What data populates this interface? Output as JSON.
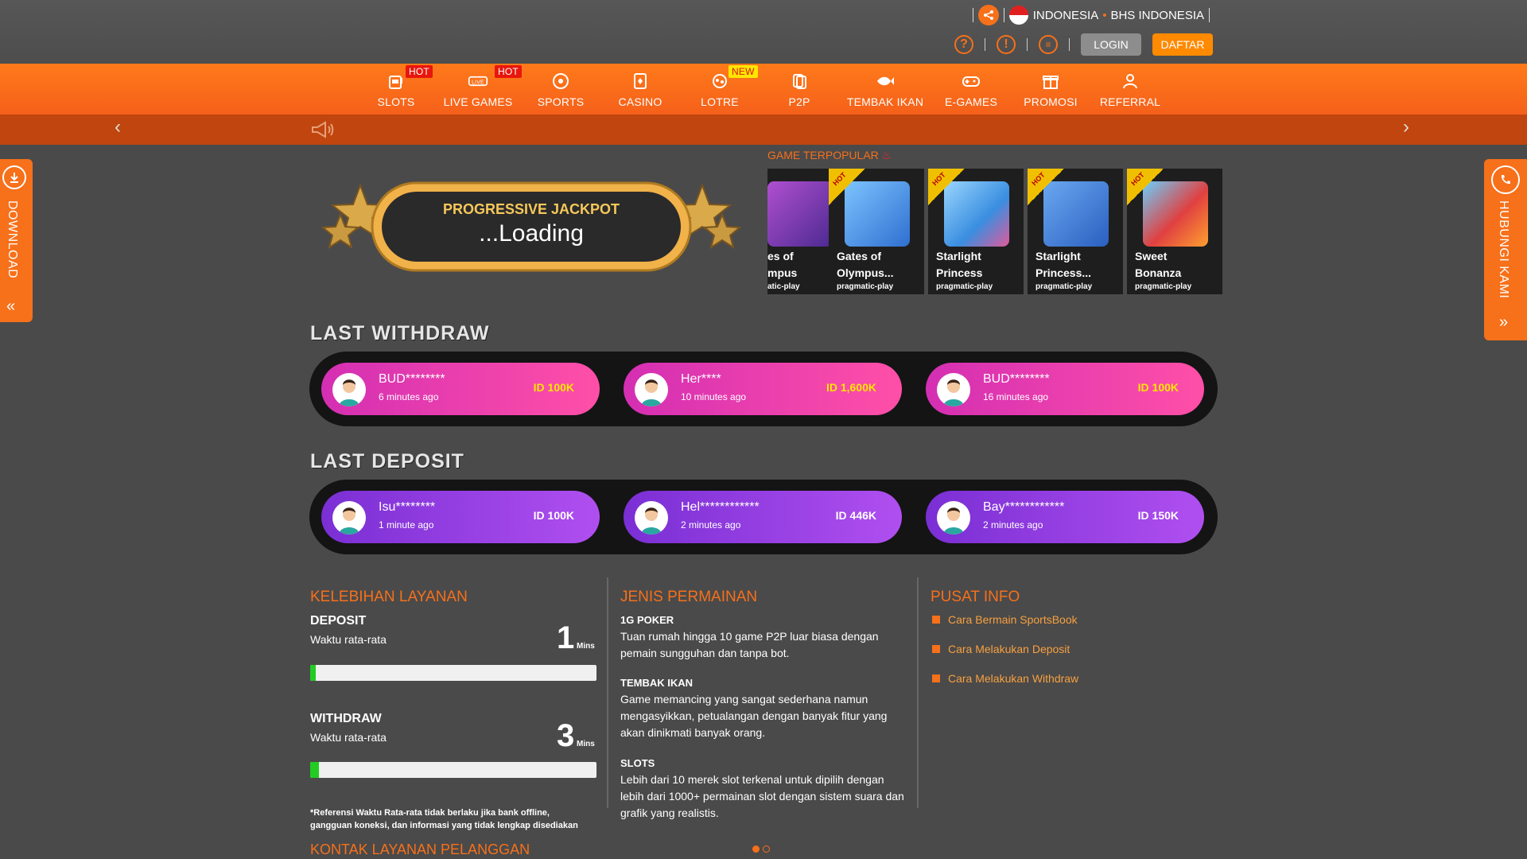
{
  "header": {
    "language": "INDONESIA",
    "language_dot": "•",
    "language_label": "BHS INDONESIA",
    "login": "LOGIN",
    "register": "DAFTAR"
  },
  "nav": [
    {
      "label": "SLOTS",
      "badge": "HOT",
      "icon": "slot-machine-icon"
    },
    {
      "label": "LIVE GAMES",
      "badge": "HOT",
      "icon": "live-icon"
    },
    {
      "label": "SPORTS",
      "badge": "",
      "icon": "soccer-ball-icon"
    },
    {
      "label": "CASINO",
      "badge": "",
      "icon": "card-icon"
    },
    {
      "label": "LOTRE",
      "badge": "NEW",
      "icon": "lottery-icon"
    },
    {
      "label": "P2P",
      "badge": "",
      "icon": "cards-icon"
    },
    {
      "label": "TEMBAK IKAN",
      "badge": "",
      "icon": "fish-icon"
    },
    {
      "label": "E-GAMES",
      "badge": "",
      "icon": "gamepad-icon"
    },
    {
      "label": "PROMOSI",
      "badge": "",
      "icon": "gift-icon"
    },
    {
      "label": "REFERRAL",
      "badge": "",
      "icon": "referral-icon"
    }
  ],
  "ticker": {
    "prev": "‹",
    "next": "›"
  },
  "side": {
    "download": "DOWNLOAD",
    "download_arrow": "«",
    "contact": "HUBUNGI KAMI",
    "contact_arrow": "»"
  },
  "jackpot": {
    "title": "PROGRESSIVE JACKPOT",
    "value": "...Loading"
  },
  "popular": {
    "title": "GAME TERPOPULAR",
    "games": [
      {
        "name1": "es of",
        "name2": "mpus",
        "provider": "atic-play",
        "hot": false,
        "color": "#7a3fb0"
      },
      {
        "name1": "Gates of",
        "name2": "Olympus...",
        "provider": "pragmatic-play",
        "hot": true,
        "color": "#2f6fd0"
      },
      {
        "name1": "Starlight",
        "name2": "Princess",
        "provider": "pragmatic-play",
        "hot": true,
        "color": "#3a8ee0"
      },
      {
        "name1": "Starlight",
        "name2": "Princess...",
        "provider": "pragmatic-play",
        "hot": true,
        "color": "#2a5fc0"
      },
      {
        "name1": "Sweet",
        "name2": "Bonanza",
        "provider": "pragmatic-play",
        "hot": true,
        "color": "#e04040"
      }
    ],
    "hot_label": "HOT"
  },
  "withdraw": {
    "title": "LAST WITHDRAW",
    "items": [
      {
        "user": "BUD********",
        "time": "6 minutes ago",
        "amount": "ID 100K"
      },
      {
        "user": "Her****",
        "time": "10 minutes ago",
        "amount": "ID 1,600K"
      },
      {
        "user": "BUD********",
        "time": "16 minutes ago",
        "amount": "ID 100K"
      }
    ]
  },
  "deposit": {
    "title": "LAST DEPOSIT",
    "items": [
      {
        "user": "Isu********",
        "time": "1 minute ago",
        "amount": "ID 100K"
      },
      {
        "user": "Hel************",
        "time": "2 minutes ago",
        "amount": "ID 446K"
      },
      {
        "user": "Bay************",
        "time": "2 minutes ago",
        "amount": "ID 150K"
      }
    ]
  },
  "service": {
    "title": "KELEBIHAN LAYANAN",
    "deposit_label": "DEPOSIT",
    "withdraw_label": "WITHDRAW",
    "avg_label": "Waktu rata-rata",
    "deposit_value": "1",
    "withdraw_value": "3",
    "unit": "Mins",
    "deposit_progress": 0.02,
    "withdraw_progress": 0.03,
    "note": "*Referensi Waktu Rata-rata tidak berlaku jika bank offline, gangguan koneksi, dan informasi yang tidak lengkap disediakan",
    "contact_title": "KONTAK LAYANAN PELANGGAN"
  },
  "games_info": {
    "title": "JENIS PERMAINAN",
    "items": [
      {
        "heading": "1G POKER",
        "text": "Tuan rumah hingga 10 game P2P luar biasa dengan pemain sungguhan dan tanpa bot."
      },
      {
        "heading": "TEMBAK IKAN",
        "text": "Game memancing yang sangat sederhana namun mengasyikkan, petualangan dengan banyak fitur yang akan dinikmati banyak orang."
      },
      {
        "heading": "SLOTS",
        "text": "Lebih dari 10 merek slot terkenal untuk dipilih dengan lebih dari 1000+ permainan slot dengan sistem suara dan grafik yang realistis."
      }
    ]
  },
  "info_center": {
    "title": "PUSAT INFO",
    "links": [
      "Cara Bermain SportsBook",
      "Cara Melakukan Deposit",
      "Cara Melakukan Withdraw"
    ]
  },
  "colors": {
    "accent": "#f7701a",
    "withdraw_card": "#e03ab0",
    "deposit_card": "#9a40e6"
  }
}
